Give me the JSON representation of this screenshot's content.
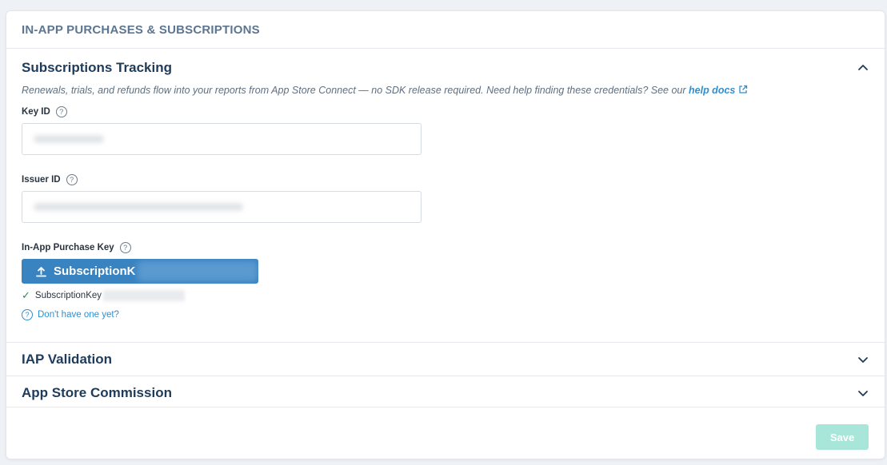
{
  "card": {
    "title": "IN-APP PURCHASES & SUBSCRIPTIONS"
  },
  "subscriptions_tracking": {
    "title": "Subscriptions Tracking",
    "expanded": true,
    "description": "Renewals, trials, and refunds flow into your reports from App Store Connect — no SDK release required. Need help finding these credentials? See our ",
    "help_link": "help docs",
    "key_id": {
      "label": "Key ID",
      "value": ""
    },
    "issuer_id": {
      "label": "Issuer ID",
      "value": ""
    },
    "iap_key": {
      "label": "In-App Purchase Key",
      "button_label": "SubscriptionK",
      "uploaded_file": "SubscriptionKey",
      "dont_have_link": "Don't have one yet?"
    }
  },
  "sections": [
    {
      "title": "IAP Validation",
      "expanded": false
    },
    {
      "title": "App Store Commission",
      "expanded": false
    }
  ],
  "footer": {
    "save_label": "Save"
  },
  "colors": {
    "heading": "#1e3b5a",
    "card_title": "#5c7590",
    "link": "#2f8fd0",
    "upload_button": "#3a83c1",
    "save_disabled": "#a9e6da",
    "check": "#2e8b57"
  },
  "icons": [
    "chevron-up-icon",
    "chevron-down-icon",
    "help-circle-icon",
    "external-link-icon",
    "upload-icon",
    "check-icon"
  ]
}
